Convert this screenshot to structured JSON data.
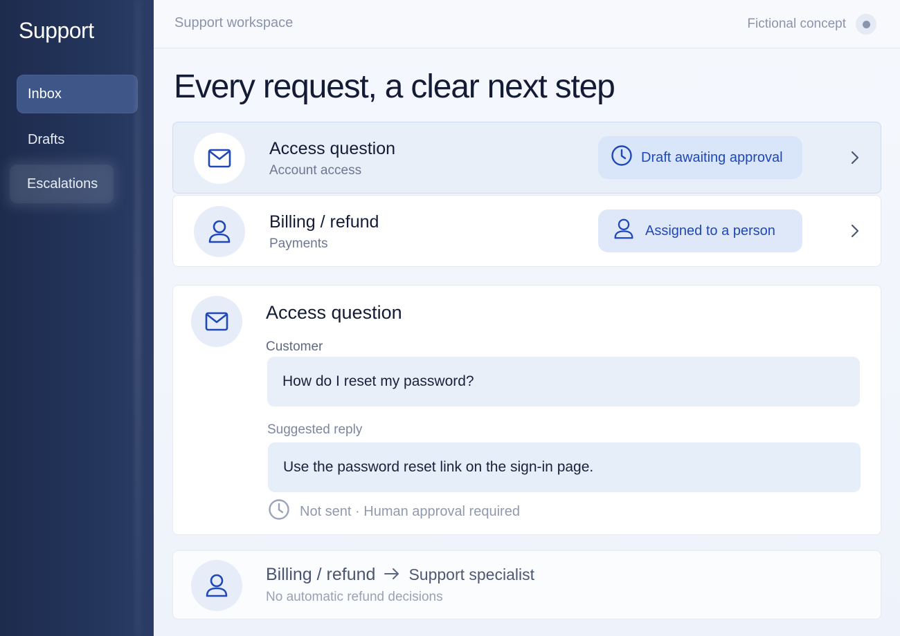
{
  "sidebar": {
    "brand": "Support",
    "items": [
      {
        "label": "Inbox",
        "active": true
      },
      {
        "label": "Drafts",
        "active": false
      },
      {
        "label": "Escalations",
        "active": false
      }
    ]
  },
  "topbar": {
    "workspace": "Support workspace",
    "concept_label": "Fictional concept"
  },
  "hero": {
    "title": "Every request, a clear next step"
  },
  "requests": [
    {
      "icon": "mail-icon",
      "title": "Access question",
      "subtitle": "Account access",
      "status_icon": "clock-icon",
      "status": "Draft awaiting approval",
      "selected": true
    },
    {
      "icon": "person-icon",
      "title": "Billing / refund",
      "subtitle": "Payments",
      "status_icon": "person-icon",
      "status": "Assigned to a person",
      "selected": false
    }
  ],
  "detail": {
    "icon": "mail-icon",
    "title": "Access question",
    "customer_label": "Customer",
    "customer_message": "How do I reset my password?",
    "reply_label": "Suggested reply",
    "reply_message": "Use the password reset link on the sign-in page.",
    "status_icon": "clock-icon",
    "status": "Not sent · Human approval required"
  },
  "handoff": {
    "icon": "person-icon",
    "from": "Billing / refund",
    "arrow_icon": "arrow-right-icon",
    "to": "Support specialist",
    "note": "No automatic refund decisions"
  },
  "colors": {
    "sidebar_bg": "#23345a",
    "accent": "#1f47b8",
    "pill_bg": "#d9e5f8",
    "heading": "#141c35"
  }
}
